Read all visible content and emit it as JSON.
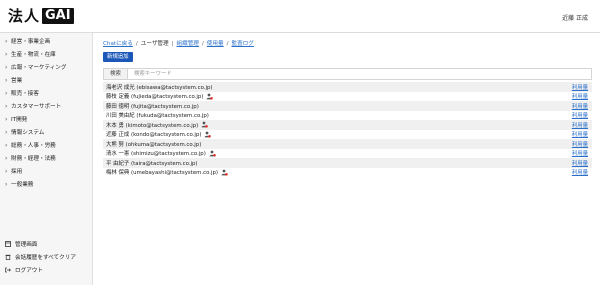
{
  "header": {
    "logo_text": "法人",
    "logo_box": "GAI",
    "user_name": "近藤 正成"
  },
  "sidebar": {
    "items": [
      {
        "label": "経営・事業企画"
      },
      {
        "label": "生産・物流・在庫"
      },
      {
        "label": "広報・マーケティング"
      },
      {
        "label": "営業"
      },
      {
        "label": "販売・接客"
      },
      {
        "label": "カスタマーサポート"
      },
      {
        "label": "IT開発"
      },
      {
        "label": "情報システム"
      },
      {
        "label": "総務・人事・労務"
      },
      {
        "label": "財務・経理・法務"
      },
      {
        "label": "採用"
      },
      {
        "label": "一般業務"
      }
    ],
    "bottom": [
      {
        "label": "管理画面",
        "icon": "admin-icon"
      },
      {
        "label": "会話履歴をすべてクリア",
        "icon": "trash-icon"
      },
      {
        "label": "ログアウト",
        "icon": "logout-icon"
      }
    ]
  },
  "breadcrumb": {
    "back": "Chatに戻る",
    "current": "ユーザ管理",
    "links": [
      "組織管理",
      "使用量",
      "監査ログ"
    ]
  },
  "add_button": "新規追加",
  "search": {
    "label": "検索",
    "placeholder": "検索キーワード"
  },
  "users": [
    {
      "name": "海老沢 成光 (ebisawa@tactsystem.co.jp)",
      "admin": false,
      "link": "利用量"
    },
    {
      "name": "藤枝 定義 (fujieda@tactsystem.co.jp)",
      "admin": true,
      "link": "利用量"
    },
    {
      "name": "藤田 徳明 (fujita@tactsystem.co.jp)",
      "admin": false,
      "link": "利用量"
    },
    {
      "name": "川田 美由紀 (fukuda@tactsystem.co.jp)",
      "admin": false,
      "link": "利用量"
    },
    {
      "name": "木本 勇 (kimoto@tactsystem.co.jp)",
      "admin": true,
      "link": "利用量"
    },
    {
      "name": "近藤 正成 (kondo@tactsystem.co.jp)",
      "admin": true,
      "link": "利用量"
    },
    {
      "name": "大熊 努 (ohkuma@tactsystem.co.jp)",
      "admin": false,
      "link": "利用量"
    },
    {
      "name": "清水 一憲 (shimizu@tactsystem.co.jp)",
      "admin": true,
      "link": "利用量"
    },
    {
      "name": "平 由紀子 (taira@tactsystem.co.jp)",
      "admin": false,
      "link": "利用量"
    },
    {
      "name": "梅林 保典 (umebayashi@tactsystem.co.jp)",
      "admin": true,
      "link": "利用量"
    }
  ]
}
